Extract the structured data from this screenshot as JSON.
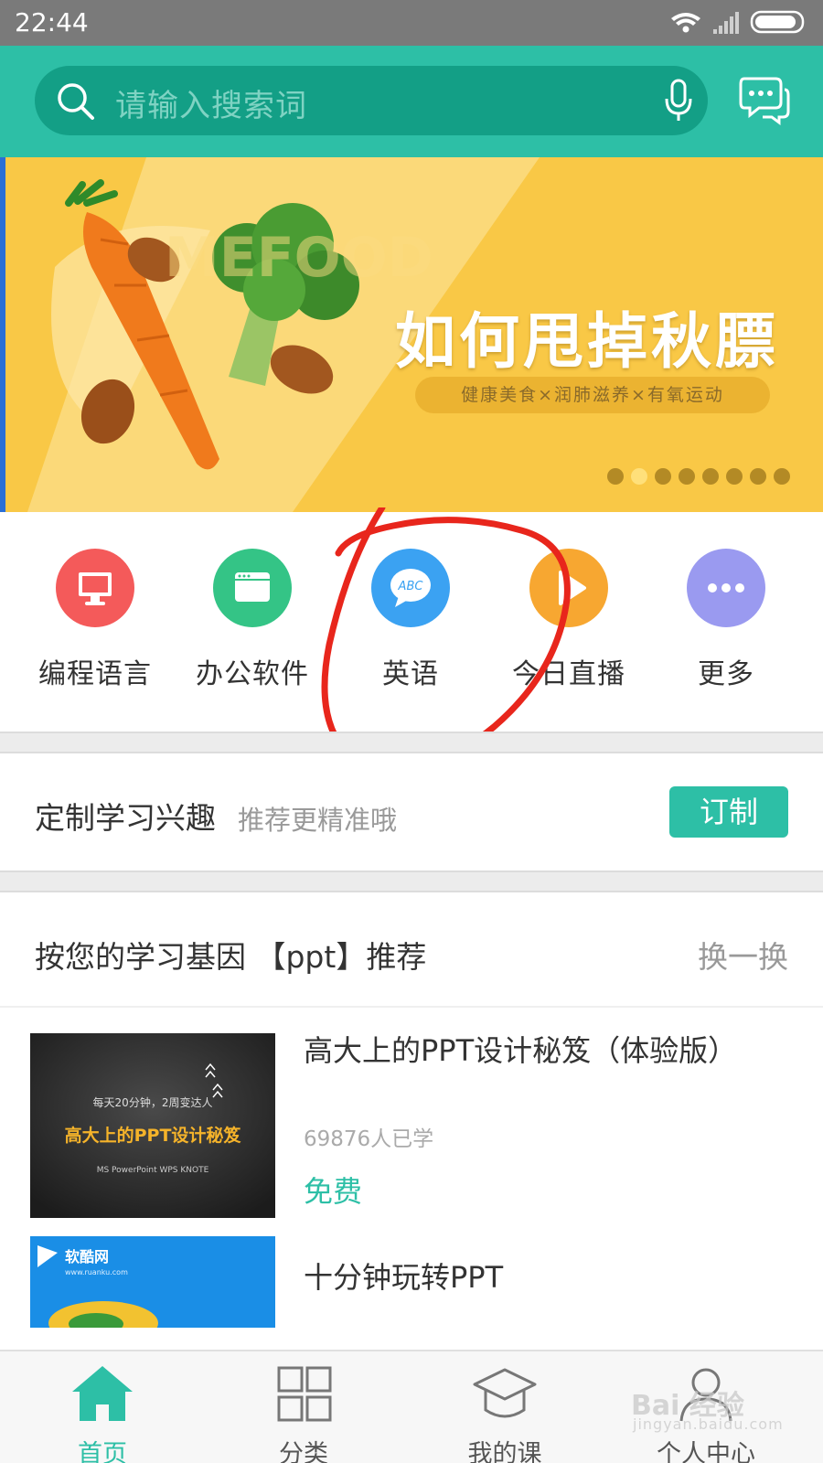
{
  "status_bar": {
    "time": "22:44"
  },
  "search": {
    "placeholder": "请输入搜索词"
  },
  "banner": {
    "title": "如何甩掉秋膘",
    "subtitle": "健康美食×润肺滋养×有氧运动",
    "slide_count": 8,
    "active_slide": 1
  },
  "categories": [
    {
      "label": "编程语言",
      "icon": "monitor-icon",
      "color": "#f45a5a"
    },
    {
      "label": "办公软件",
      "icon": "window-icon",
      "color": "#34c486"
    },
    {
      "label": "英语",
      "icon": "abc-chat-icon",
      "color": "#3ba2f2",
      "icon_text": "ABC"
    },
    {
      "label": "今日直播",
      "icon": "play-icon",
      "color": "#f7a731"
    },
    {
      "label": "更多",
      "icon": "more-icon",
      "color": "#9a9af0"
    }
  ],
  "customize": {
    "title": "定制学习兴趣",
    "subtitle": "推荐更精准哦",
    "button": "订制"
  },
  "recommend": {
    "title": "按您的学习基因 【ppt】推荐",
    "refresh": "换一换"
  },
  "courses": [
    {
      "title": "高大上的PPT设计秘笈（体验版）",
      "learners": "69876人已学",
      "price": "免费",
      "thumb": {
        "tagline": "每天20分钟，2周变达人",
        "headline": "高大上的PPT设计秘笈",
        "logos": "MS PowerPoint  WPS  KNOTE"
      }
    },
    {
      "title": "十分钟玩转PPT",
      "learners": "",
      "price": "",
      "thumb": {
        "brand": "软酷网",
        "brand_url": "www.ruanku.com"
      }
    }
  ],
  "bottom_nav": [
    {
      "label": "首页",
      "icon": "home-icon",
      "active": true
    },
    {
      "label": "分类",
      "icon": "grid-icon",
      "active": false
    },
    {
      "label": "我的课",
      "icon": "graduation-cap-icon",
      "active": false
    },
    {
      "label": "个人中心",
      "icon": "user-icon",
      "active": false
    }
  ],
  "watermark": {
    "text": "Bai 经验",
    "url": "jingyan.baidu.com"
  },
  "colors": {
    "accent": "#2dbfa6",
    "banner": "#f9c846",
    "annotation": "#e8261c"
  }
}
